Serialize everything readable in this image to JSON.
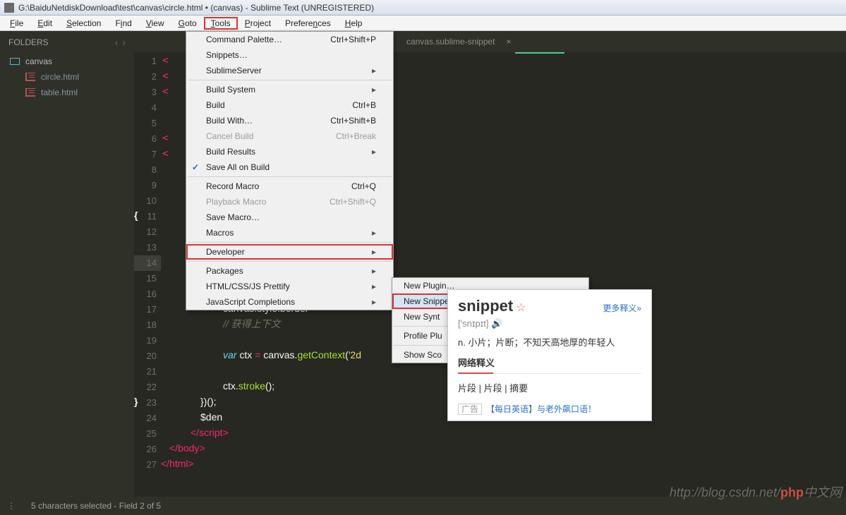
{
  "titlebar": {
    "path": "G:\\BaiduNetdiskDownload\\test\\canvas\\circle.html • (canvas) - Sublime Text (UNREGISTERED)"
  },
  "menubar": {
    "file": "File",
    "edit": "Edit",
    "selection": "Selection",
    "find": "Find",
    "view": "View",
    "goto": "Goto",
    "tools": "Tools",
    "project": "Project",
    "preferences": "Preferences",
    "help": "Help"
  },
  "sidebar": {
    "title": "FOLDERS",
    "folder": "canvas",
    "files": [
      "circle.html",
      "table.html"
    ]
  },
  "tabs": {
    "tab2": "canvas.sublime-snippet"
  },
  "gutter": [
    "1",
    "2",
    "3",
    "4",
    "5",
    "6",
    "7",
    "8",
    "9",
    "10",
    "11",
    "12",
    "13",
    "14",
    "15",
    "16",
    "17",
    "18",
    "19",
    "20",
    "21",
    "22",
    "23",
    "24",
    "25",
    "26",
    "27"
  ],
  "code": {
    "l17": "canvas.style.border =",
    "l18": "// 获得上下文",
    "l20a": "var",
    "l20b": " ctx ",
    "l20c": "=",
    "l20d": " canvas.",
    "l20e": "getContext",
    "l20f": "(",
    "l20g": "'2d",
    "l22a": "ctx.",
    "l22b": "stroke",
    "l22c": "();",
    "l23": "})();",
    "l24": "$den",
    "l25a": "</",
    "l25b": "script",
    "l25c": ">",
    "l26a": "</",
    "l26b": "body",
    "l26c": ">",
    "l27a": "</",
    "l27b": "html",
    "l27c": ">"
  },
  "tools_menu": {
    "palette": "Command Palette…",
    "palette_sc": "Ctrl+Shift+P",
    "snippets": "Snippets…",
    "subserver": "SublimeServer",
    "buildsys": "Build System",
    "build": "Build",
    "build_sc": "Ctrl+B",
    "buildwith": "Build With…",
    "buildwith_sc": "Ctrl+Shift+B",
    "cancel": "Cancel Build",
    "cancel_sc": "Ctrl+Break",
    "results": "Build Results",
    "saveall": "Save All on Build",
    "record": "Record Macro",
    "record_sc": "Ctrl+Q",
    "playback": "Playback Macro",
    "playback_sc": "Ctrl+Shift+Q",
    "savemacro": "Save Macro…",
    "macros": "Macros",
    "developer": "Developer",
    "packages": "Packages",
    "prettify": "HTML/CSS/JS Prettify",
    "jscomp": "JavaScript Completions"
  },
  "dev_submenu": {
    "newplugin": "New Plugin…",
    "newsnippet": "New Snippet…",
    "newsyntax": "New Synt",
    "profile": "Profile Plu",
    "showscope": "Show Sco"
  },
  "dict": {
    "word": "snippet",
    "more": "更多释义»",
    "phon": "['snɪpɪt]",
    "def": "n. 小片；片断；不知天高地厚的年轻人",
    "net_title": "网络释义",
    "trans": "片段 | 片段 | 摘要",
    "ad_tag": "广告",
    "ad_text": "【每日英语】与老外飙口语！"
  },
  "status": {
    "text": "5 characters selected - Field 2 of 5"
  },
  "watermark": {
    "url": "http://blog.csdn.net/",
    "brand": "php",
    "suffix": "中文网"
  }
}
